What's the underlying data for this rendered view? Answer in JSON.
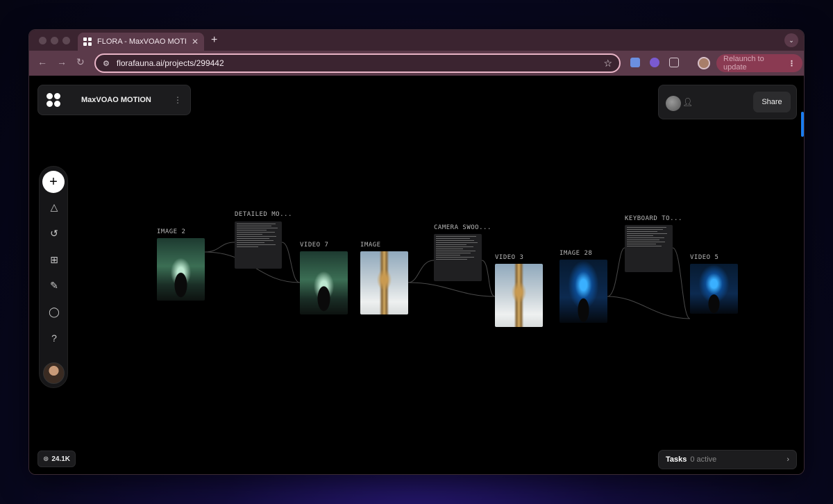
{
  "browser": {
    "tab_title": "FLORA - MaxVOAO MOTION",
    "tab_close": "✕",
    "new_tab": "+",
    "tab_menu": "⌄",
    "url": "florafauna.ai/projects/299442",
    "relaunch_label": "Relaunch to update",
    "relaunch_menu": "⋮"
  },
  "header": {
    "project_name": "MaxVOAO MOTION",
    "menu_glyph": "⋮",
    "share_label": "Share"
  },
  "sidebar": {
    "add_glyph": "+",
    "items": [
      {
        "name": "shapes-icon",
        "glyph": "△"
      },
      {
        "name": "history-icon",
        "glyph": "↺"
      },
      {
        "name": "templates-icon",
        "glyph": "⊞"
      },
      {
        "name": "brush-icon",
        "glyph": "✎"
      },
      {
        "name": "chat-icon",
        "glyph": "◯"
      },
      {
        "name": "help-icon",
        "glyph": "?"
      }
    ]
  },
  "footer": {
    "credits": "24.1K",
    "tasks_label": "Tasks",
    "tasks_count": "0 active",
    "tasks_chevron": "›"
  },
  "canvas": {
    "nodes": [
      {
        "label": "IMAGE 2"
      },
      {
        "label": "DETAILED MO..."
      },
      {
        "label": "VIDEO 7"
      },
      {
        "label": "IMAGE"
      },
      {
        "label": "CAMERA SWOO..."
      },
      {
        "label": "VIDEO 3"
      },
      {
        "label": "IMAGE 28"
      },
      {
        "label": "KEYBOARD TO..."
      },
      {
        "label": "VIDEO 5"
      }
    ]
  },
  "colors": {
    "accent_blue": "#1a7cf0",
    "chrome_bg": "#5b3a4a",
    "relaunch_bg": "#8a3a52",
    "canvas_bg": "#000000"
  }
}
